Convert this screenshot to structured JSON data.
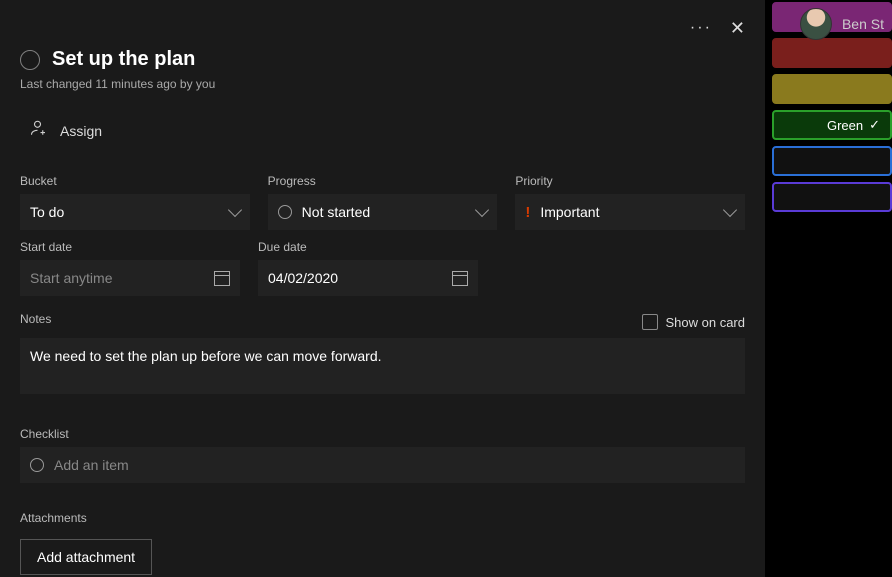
{
  "topbar": {
    "user_name": "Ben St"
  },
  "sidebar": {
    "swatches": [
      {
        "color": "pink"
      },
      {
        "color": "red"
      },
      {
        "color": "yellow"
      },
      {
        "color": "green",
        "label": "Green",
        "selected": true
      },
      {
        "color": "blue"
      },
      {
        "color": "purple"
      }
    ]
  },
  "task": {
    "title": "Set up the plan",
    "last_changed": "Last changed 11 minutes ago by you",
    "assign_label": "Assign",
    "fields": {
      "bucket": {
        "label": "Bucket",
        "value": "To do"
      },
      "progress": {
        "label": "Progress",
        "value": "Not started"
      },
      "priority": {
        "label": "Priority",
        "value": "Important"
      },
      "start_date": {
        "label": "Start date",
        "placeholder": "Start anytime",
        "value": ""
      },
      "due_date": {
        "label": "Due date",
        "value": "04/02/2020"
      }
    },
    "notes": {
      "label": "Notes",
      "show_on_card_label": "Show on card",
      "show_on_card_checked": false,
      "value": "We need to set the plan up before we can move forward."
    },
    "checklist": {
      "label": "Checklist",
      "add_item_placeholder": "Add an item"
    },
    "attachments": {
      "label": "Attachments",
      "add_button": "Add attachment"
    }
  }
}
